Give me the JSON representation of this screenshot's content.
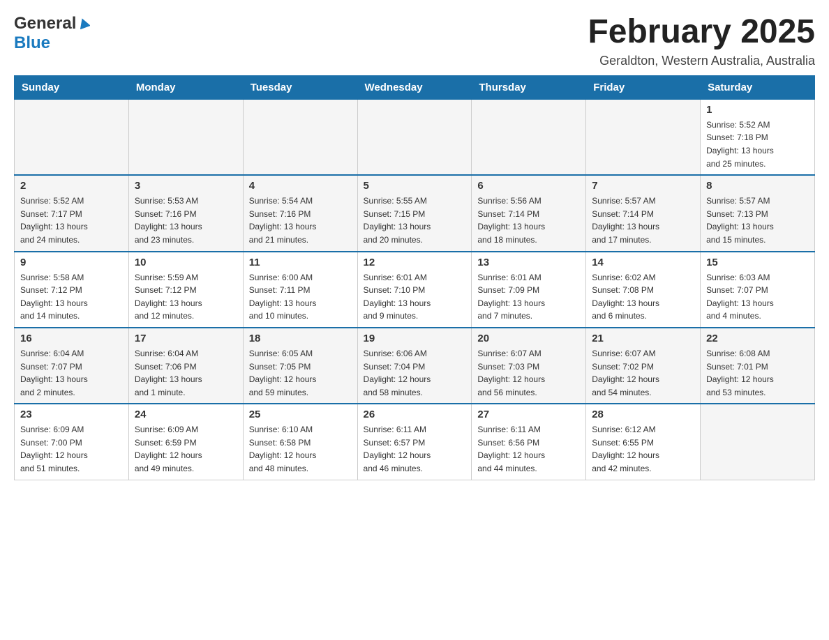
{
  "header": {
    "logo": {
      "general": "General",
      "blue": "Blue",
      "triangle_alt": "triangle"
    },
    "title": "February 2025",
    "location": "Geraldton, Western Australia, Australia"
  },
  "days_of_week": [
    "Sunday",
    "Monday",
    "Tuesday",
    "Wednesday",
    "Thursday",
    "Friday",
    "Saturday"
  ],
  "weeks": [
    {
      "days": [
        {
          "num": "",
          "info": ""
        },
        {
          "num": "",
          "info": ""
        },
        {
          "num": "",
          "info": ""
        },
        {
          "num": "",
          "info": ""
        },
        {
          "num": "",
          "info": ""
        },
        {
          "num": "",
          "info": ""
        },
        {
          "num": "1",
          "info": "Sunrise: 5:52 AM\nSunset: 7:18 PM\nDaylight: 13 hours\nand 25 minutes."
        }
      ]
    },
    {
      "days": [
        {
          "num": "2",
          "info": "Sunrise: 5:52 AM\nSunset: 7:17 PM\nDaylight: 13 hours\nand 24 minutes."
        },
        {
          "num": "3",
          "info": "Sunrise: 5:53 AM\nSunset: 7:16 PM\nDaylight: 13 hours\nand 23 minutes."
        },
        {
          "num": "4",
          "info": "Sunrise: 5:54 AM\nSunset: 7:16 PM\nDaylight: 13 hours\nand 21 minutes."
        },
        {
          "num": "5",
          "info": "Sunrise: 5:55 AM\nSunset: 7:15 PM\nDaylight: 13 hours\nand 20 minutes."
        },
        {
          "num": "6",
          "info": "Sunrise: 5:56 AM\nSunset: 7:14 PM\nDaylight: 13 hours\nand 18 minutes."
        },
        {
          "num": "7",
          "info": "Sunrise: 5:57 AM\nSunset: 7:14 PM\nDaylight: 13 hours\nand 17 minutes."
        },
        {
          "num": "8",
          "info": "Sunrise: 5:57 AM\nSunset: 7:13 PM\nDaylight: 13 hours\nand 15 minutes."
        }
      ]
    },
    {
      "days": [
        {
          "num": "9",
          "info": "Sunrise: 5:58 AM\nSunset: 7:12 PM\nDaylight: 13 hours\nand 14 minutes."
        },
        {
          "num": "10",
          "info": "Sunrise: 5:59 AM\nSunset: 7:12 PM\nDaylight: 13 hours\nand 12 minutes."
        },
        {
          "num": "11",
          "info": "Sunrise: 6:00 AM\nSunset: 7:11 PM\nDaylight: 13 hours\nand 10 minutes."
        },
        {
          "num": "12",
          "info": "Sunrise: 6:01 AM\nSunset: 7:10 PM\nDaylight: 13 hours\nand 9 minutes."
        },
        {
          "num": "13",
          "info": "Sunrise: 6:01 AM\nSunset: 7:09 PM\nDaylight: 13 hours\nand 7 minutes."
        },
        {
          "num": "14",
          "info": "Sunrise: 6:02 AM\nSunset: 7:08 PM\nDaylight: 13 hours\nand 6 minutes."
        },
        {
          "num": "15",
          "info": "Sunrise: 6:03 AM\nSunset: 7:07 PM\nDaylight: 13 hours\nand 4 minutes."
        }
      ]
    },
    {
      "days": [
        {
          "num": "16",
          "info": "Sunrise: 6:04 AM\nSunset: 7:07 PM\nDaylight: 13 hours\nand 2 minutes."
        },
        {
          "num": "17",
          "info": "Sunrise: 6:04 AM\nSunset: 7:06 PM\nDaylight: 13 hours\nand 1 minute."
        },
        {
          "num": "18",
          "info": "Sunrise: 6:05 AM\nSunset: 7:05 PM\nDaylight: 12 hours\nand 59 minutes."
        },
        {
          "num": "19",
          "info": "Sunrise: 6:06 AM\nSunset: 7:04 PM\nDaylight: 12 hours\nand 58 minutes."
        },
        {
          "num": "20",
          "info": "Sunrise: 6:07 AM\nSunset: 7:03 PM\nDaylight: 12 hours\nand 56 minutes."
        },
        {
          "num": "21",
          "info": "Sunrise: 6:07 AM\nSunset: 7:02 PM\nDaylight: 12 hours\nand 54 minutes."
        },
        {
          "num": "22",
          "info": "Sunrise: 6:08 AM\nSunset: 7:01 PM\nDaylight: 12 hours\nand 53 minutes."
        }
      ]
    },
    {
      "days": [
        {
          "num": "23",
          "info": "Sunrise: 6:09 AM\nSunset: 7:00 PM\nDaylight: 12 hours\nand 51 minutes."
        },
        {
          "num": "24",
          "info": "Sunrise: 6:09 AM\nSunset: 6:59 PM\nDaylight: 12 hours\nand 49 minutes."
        },
        {
          "num": "25",
          "info": "Sunrise: 6:10 AM\nSunset: 6:58 PM\nDaylight: 12 hours\nand 48 minutes."
        },
        {
          "num": "26",
          "info": "Sunrise: 6:11 AM\nSunset: 6:57 PM\nDaylight: 12 hours\nand 46 minutes."
        },
        {
          "num": "27",
          "info": "Sunrise: 6:11 AM\nSunset: 6:56 PM\nDaylight: 12 hours\nand 44 minutes."
        },
        {
          "num": "28",
          "info": "Sunrise: 6:12 AM\nSunset: 6:55 PM\nDaylight: 12 hours\nand 42 minutes."
        },
        {
          "num": "",
          "info": ""
        }
      ]
    }
  ]
}
